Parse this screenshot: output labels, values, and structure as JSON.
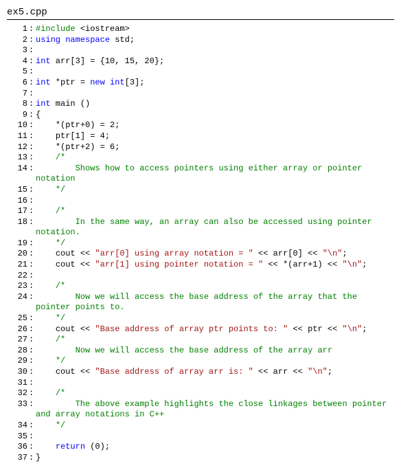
{
  "title": "ex5.cpp",
  "lines": [
    {
      "n": 1,
      "segs": [
        {
          "c": "pre",
          "t": "#include "
        },
        {
          "c": "txt",
          "t": "<iostream>"
        }
      ]
    },
    {
      "n": 2,
      "segs": [
        {
          "c": "kw",
          "t": "using"
        },
        {
          "c": "txt",
          "t": " "
        },
        {
          "c": "kw",
          "t": "namespace"
        },
        {
          "c": "txt",
          "t": " std;"
        }
      ]
    },
    {
      "n": 3,
      "segs": [
        {
          "c": "txt",
          "t": ""
        }
      ]
    },
    {
      "n": 4,
      "segs": [
        {
          "c": "kw",
          "t": "int"
        },
        {
          "c": "txt",
          "t": " arr[3] = {10, 15, 20};"
        }
      ]
    },
    {
      "n": 5,
      "segs": [
        {
          "c": "txt",
          "t": ""
        }
      ]
    },
    {
      "n": 6,
      "segs": [
        {
          "c": "kw",
          "t": "int"
        },
        {
          "c": "txt",
          "t": " *ptr = "
        },
        {
          "c": "kw",
          "t": "new"
        },
        {
          "c": "txt",
          "t": " "
        },
        {
          "c": "kw",
          "t": "int"
        },
        {
          "c": "txt",
          "t": "[3];"
        }
      ]
    },
    {
      "n": 7,
      "segs": [
        {
          "c": "txt",
          "t": ""
        }
      ]
    },
    {
      "n": 8,
      "segs": [
        {
          "c": "kw",
          "t": "int"
        },
        {
          "c": "txt",
          "t": " main ()"
        }
      ]
    },
    {
      "n": 9,
      "segs": [
        {
          "c": "txt",
          "t": "{"
        }
      ]
    },
    {
      "n": 10,
      "segs": [
        {
          "c": "txt",
          "t": "    *(ptr+0) = 2;"
        }
      ]
    },
    {
      "n": 11,
      "segs": [
        {
          "c": "txt",
          "t": "    ptr[1] = 4;"
        }
      ]
    },
    {
      "n": 12,
      "segs": [
        {
          "c": "txt",
          "t": "    *(ptr+2) = 6;"
        }
      ]
    },
    {
      "n": 13,
      "segs": [
        {
          "c": "cm",
          "t": "    /*"
        }
      ]
    },
    {
      "n": 14,
      "segs": [
        {
          "c": "cm",
          "t": "        Shows how to access pointers using either array or pointer notation"
        }
      ]
    },
    {
      "n": 15,
      "segs": [
        {
          "c": "cm",
          "t": "    */"
        }
      ]
    },
    {
      "n": 16,
      "segs": [
        {
          "c": "txt",
          "t": ""
        }
      ]
    },
    {
      "n": 17,
      "segs": [
        {
          "c": "cm",
          "t": "    /*"
        }
      ]
    },
    {
      "n": 18,
      "segs": [
        {
          "c": "cm",
          "t": "        In the same way, an array can also be accessed using pointer notation."
        }
      ]
    },
    {
      "n": 19,
      "segs": [
        {
          "c": "cm",
          "t": "    */"
        }
      ]
    },
    {
      "n": 20,
      "segs": [
        {
          "c": "txt",
          "t": "    cout << "
        },
        {
          "c": "str",
          "t": "\"arr[0] using array notation = \""
        },
        {
          "c": "txt",
          "t": " << arr[0] << "
        },
        {
          "c": "str",
          "t": "\"\\n\""
        },
        {
          "c": "txt",
          "t": ";"
        }
      ]
    },
    {
      "n": 21,
      "segs": [
        {
          "c": "txt",
          "t": "    cout << "
        },
        {
          "c": "str",
          "t": "\"arr[1] using pointer notation = \""
        },
        {
          "c": "txt",
          "t": " << *(arr+1) << "
        },
        {
          "c": "str",
          "t": "\"\\n\""
        },
        {
          "c": "txt",
          "t": ";"
        }
      ]
    },
    {
      "n": 22,
      "segs": [
        {
          "c": "txt",
          "t": ""
        }
      ]
    },
    {
      "n": 23,
      "segs": [
        {
          "c": "cm",
          "t": "    /*"
        }
      ]
    },
    {
      "n": 24,
      "segs": [
        {
          "c": "cm",
          "t": "        Now we will access the base address of the array that the pointer points to."
        }
      ]
    },
    {
      "n": 25,
      "segs": [
        {
          "c": "cm",
          "t": "    */"
        }
      ]
    },
    {
      "n": 26,
      "segs": [
        {
          "c": "txt",
          "t": "    cout << "
        },
        {
          "c": "str",
          "t": "\"Base address of array ptr points to: \""
        },
        {
          "c": "txt",
          "t": " << ptr << "
        },
        {
          "c": "str",
          "t": "\"\\n\""
        },
        {
          "c": "txt",
          "t": ";"
        }
      ]
    },
    {
      "n": 27,
      "segs": [
        {
          "c": "cm",
          "t": "    /*"
        }
      ]
    },
    {
      "n": 28,
      "segs": [
        {
          "c": "cm",
          "t": "        Now we will access the base address of the array arr"
        }
      ]
    },
    {
      "n": 29,
      "segs": [
        {
          "c": "cm",
          "t": "    */"
        }
      ]
    },
    {
      "n": 30,
      "segs": [
        {
          "c": "txt",
          "t": "    cout << "
        },
        {
          "c": "str",
          "t": "\"Base address of array arr is: \""
        },
        {
          "c": "txt",
          "t": " << arr << "
        },
        {
          "c": "str",
          "t": "\"\\n\""
        },
        {
          "c": "txt",
          "t": ";"
        }
      ]
    },
    {
      "n": 31,
      "segs": [
        {
          "c": "txt",
          "t": ""
        }
      ]
    },
    {
      "n": 32,
      "segs": [
        {
          "c": "cm",
          "t": "    /*"
        }
      ]
    },
    {
      "n": 33,
      "segs": [
        {
          "c": "cm",
          "t": "        The above example highlights the close linkages between pointer and array notations in C++"
        }
      ]
    },
    {
      "n": 34,
      "segs": [
        {
          "c": "cm",
          "t": "    */"
        }
      ]
    },
    {
      "n": 35,
      "segs": [
        {
          "c": "txt",
          "t": ""
        }
      ]
    },
    {
      "n": 36,
      "segs": [
        {
          "c": "txt",
          "t": "    "
        },
        {
          "c": "kw",
          "t": "return"
        },
        {
          "c": "txt",
          "t": " (0);"
        }
      ]
    },
    {
      "n": 37,
      "segs": [
        {
          "c": "txt",
          "t": "}"
        }
      ]
    }
  ]
}
